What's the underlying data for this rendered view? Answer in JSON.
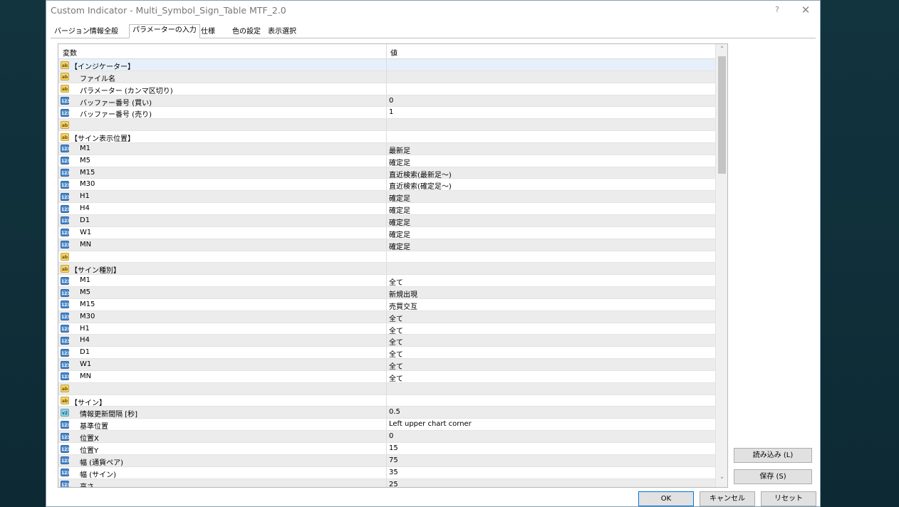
{
  "window": {
    "title": "Custom Indicator - Multi_Symbol_Sign_Table MTF_2.0",
    "help_glyph": "?",
    "close_glyph": "✕"
  },
  "tabs": [
    {
      "label": "バージョン情報",
      "active": false
    },
    {
      "label": "全般",
      "active": false
    },
    {
      "label": "パラメーターの入力",
      "active": true
    },
    {
      "label": "仕様",
      "active": false
    },
    {
      "label": "色の設定",
      "active": false
    },
    {
      "label": "表示選択",
      "active": false
    }
  ],
  "table": {
    "col_variable": "変数",
    "col_value": "値",
    "rows": [
      {
        "icon": "ab",
        "name": "【インジケーター】",
        "value": "",
        "kind": "section"
      },
      {
        "icon": "ab",
        "name": "ファイル名",
        "value": "",
        "kind": "item"
      },
      {
        "icon": "ab",
        "name": "パラメーター (カンマ区切り)",
        "value": "",
        "kind": "item"
      },
      {
        "icon": "123",
        "name": "バッファー番号 (買い)",
        "value": "0",
        "kind": "item"
      },
      {
        "icon": "123",
        "name": "バッファー番号 (売り)",
        "value": "1",
        "kind": "item"
      },
      {
        "icon": "ab",
        "name": "",
        "value": "",
        "kind": "section"
      },
      {
        "icon": "ab",
        "name": "【サイン表示位置】",
        "value": "",
        "kind": "section"
      },
      {
        "icon": "123",
        "name": "M1",
        "value": "最新足",
        "kind": "item"
      },
      {
        "icon": "123",
        "name": "M5",
        "value": "確定足",
        "kind": "item"
      },
      {
        "icon": "123",
        "name": "M15",
        "value": "直近検索(最新足〜)",
        "kind": "item"
      },
      {
        "icon": "123",
        "name": "M30",
        "value": "直近検索(確定足〜)",
        "kind": "item"
      },
      {
        "icon": "123",
        "name": "H1",
        "value": "確定足",
        "kind": "item"
      },
      {
        "icon": "123",
        "name": "H4",
        "value": "確定足",
        "kind": "item"
      },
      {
        "icon": "123",
        "name": "D1",
        "value": "確定足",
        "kind": "item"
      },
      {
        "icon": "123",
        "name": "W1",
        "value": "確定足",
        "kind": "item"
      },
      {
        "icon": "123",
        "name": "MN",
        "value": "確定足",
        "kind": "item"
      },
      {
        "icon": "ab",
        "name": "",
        "value": "",
        "kind": "section"
      },
      {
        "icon": "ab",
        "name": "【サイン種別】",
        "value": "",
        "kind": "section"
      },
      {
        "icon": "123",
        "name": "M1",
        "value": "全て",
        "kind": "item"
      },
      {
        "icon": "123",
        "name": "M5",
        "value": "新規出現",
        "kind": "item"
      },
      {
        "icon": "123",
        "name": "M15",
        "value": "売買交互",
        "kind": "item"
      },
      {
        "icon": "123",
        "name": "M30",
        "value": "全て",
        "kind": "item"
      },
      {
        "icon": "123",
        "name": "H1",
        "value": "全て",
        "kind": "item"
      },
      {
        "icon": "123",
        "name": "H4",
        "value": "全て",
        "kind": "item"
      },
      {
        "icon": "123",
        "name": "D1",
        "value": "全て",
        "kind": "item"
      },
      {
        "icon": "123",
        "name": "W1",
        "value": "全て",
        "kind": "item"
      },
      {
        "icon": "123",
        "name": "MN",
        "value": "全て",
        "kind": "item"
      },
      {
        "icon": "ab",
        "name": "",
        "value": "",
        "kind": "section"
      },
      {
        "icon": "ab",
        "name": "【サイン】",
        "value": "",
        "kind": "section"
      },
      {
        "icon": "v2",
        "name": "情報更新間隔 [秒]",
        "value": "0.5",
        "kind": "item"
      },
      {
        "icon": "123",
        "name": "基準位置",
        "value": "Left upper chart corner",
        "kind": "item"
      },
      {
        "icon": "123",
        "name": "位置X",
        "value": "0",
        "kind": "item"
      },
      {
        "icon": "123",
        "name": "位置Y",
        "value": "15",
        "kind": "item"
      },
      {
        "icon": "123",
        "name": "幅 (通貨ペア)",
        "value": "75",
        "kind": "item"
      },
      {
        "icon": "123",
        "name": "幅 (サイン)",
        "value": "35",
        "kind": "item"
      },
      {
        "icon": "123",
        "name": "高さ",
        "value": "25",
        "kind": "item"
      }
    ]
  },
  "scroll": {
    "up_glyph": "˄",
    "down_glyph": "˅"
  },
  "buttons": {
    "load": "読み込み (L)",
    "save": "保存 (S)",
    "ok": "OK",
    "cancel": "キャンセル",
    "reset": "リセット"
  }
}
